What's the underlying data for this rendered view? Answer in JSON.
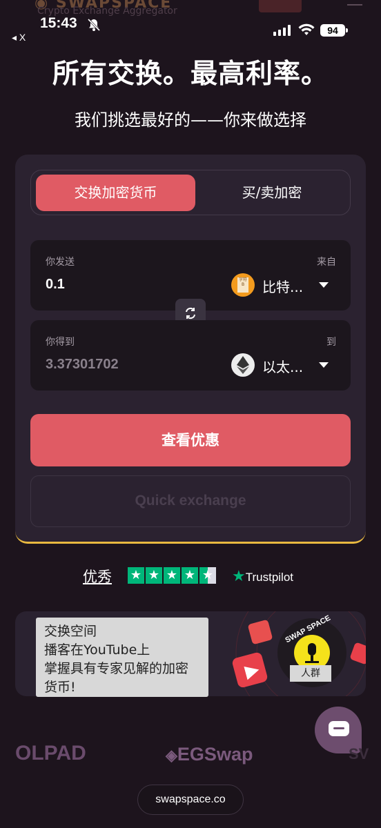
{
  "ghost_header": {
    "subtitle": "Crypto Exchange Aggregator"
  },
  "status_bar": {
    "time": "15:43",
    "back_label": "◂ X",
    "battery": "94"
  },
  "hero": {
    "title": "所有交换。最高利率。",
    "subtitle": "我们挑选最好的——你来做选择"
  },
  "tabs": [
    {
      "label": "交换加密货币",
      "active": true
    },
    {
      "label": "买/卖加密",
      "active": false
    }
  ],
  "send": {
    "label": "你发送",
    "side_label": "来自",
    "amount": "0.1",
    "coin": "比特...",
    "coin_icon_text": "字符B"
  },
  "receive": {
    "label": "你得到",
    "side_label": "到",
    "amount": "3.37301702",
    "coin": "以太..."
  },
  "cta": {
    "label": "查看优惠"
  },
  "quick": {
    "label": "Quick exchange"
  },
  "trustpilot": {
    "rating_word": "优秀",
    "brand": "Trustpilot",
    "stars": 4.5
  },
  "banner": {
    "text": "交换空间\n播客在YouTube上\n掌握具有专家见解的加密货币!",
    "badge": "人群",
    "arc_text": "SWAP SPACE"
  },
  "partners": [
    "OLPAD",
    "EGSwap",
    "SV"
  ],
  "url": "swapspace.co",
  "colors": {
    "accent": "#e05b64",
    "background": "#1d141d",
    "card": "#2b2230",
    "gold": "#e9b940",
    "trustpilot": "#00b67a"
  }
}
